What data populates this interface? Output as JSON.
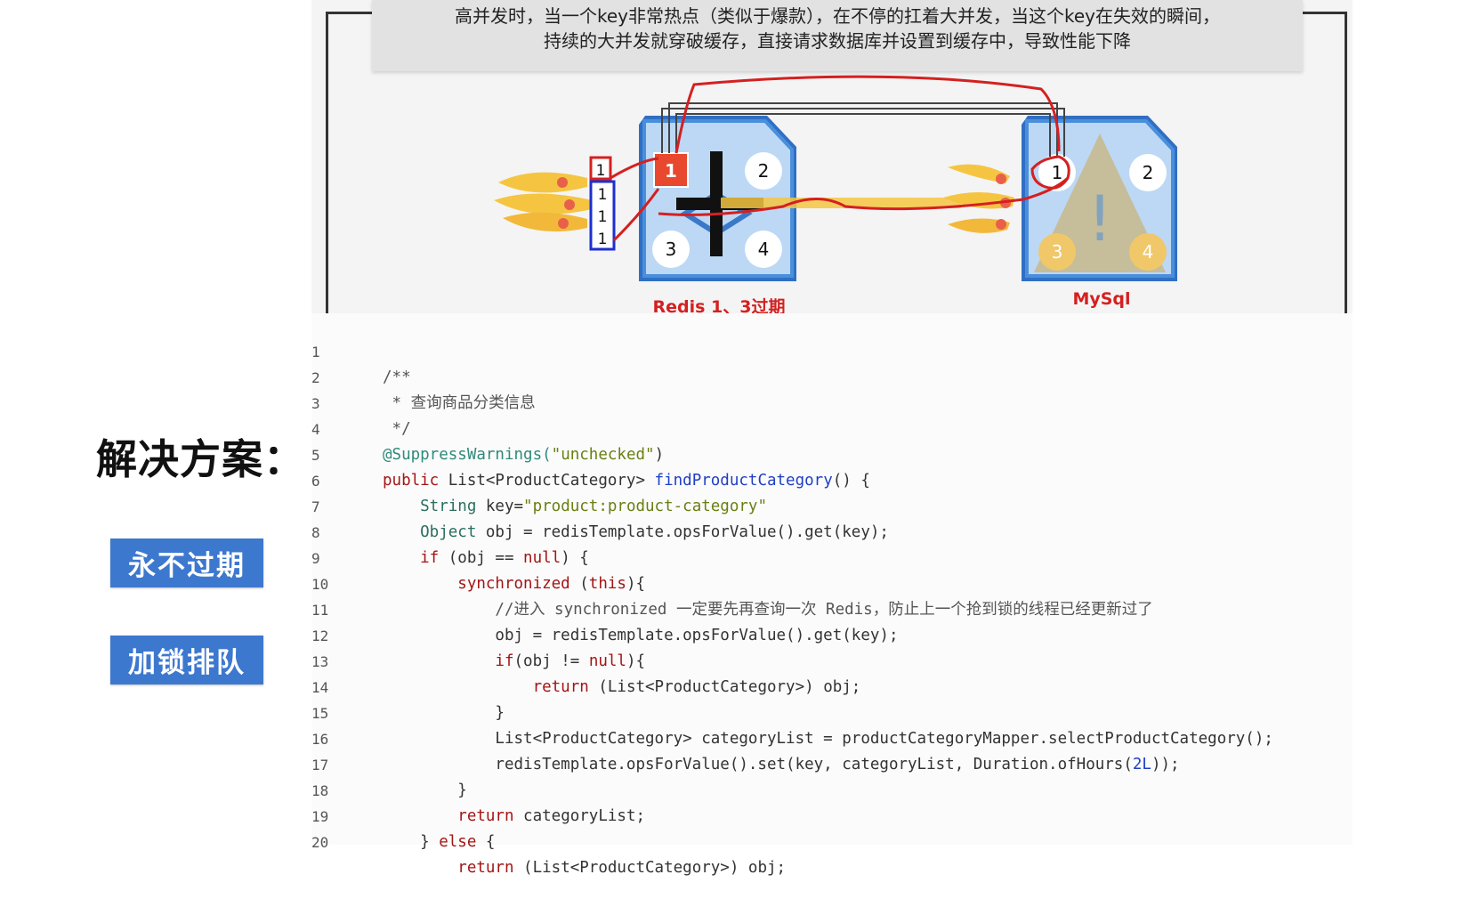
{
  "callout": {
    "line1": "高并发时，当一个key非常热点（类似于爆款），在不停的扛着大并发，当这个key在失效的瞬间，",
    "line2": "持续的大并发就穿破缓存，直接请求数据库并设置到缓存中，导致性能下降"
  },
  "diagram": {
    "redis_caption": "Redis 1、3过期",
    "mysql_caption": "MySql",
    "redis_slots": [
      "1",
      "2",
      "3",
      "4"
    ],
    "mysql_slots": [
      "1",
      "2",
      "3",
      "4"
    ],
    "queue_items": [
      "1",
      "1",
      "1",
      "1"
    ],
    "colors": {
      "annotation_red": "#d42020",
      "queue_blue": "#1c2fd0",
      "cube_blue": "#4a8fdc",
      "flame": "#f5c542"
    }
  },
  "solution": {
    "title": "解决方案：",
    "buttons": [
      "永不过期",
      "加锁排队"
    ]
  },
  "code": {
    "line_numbers": [
      "1",
      "2",
      "3",
      "4",
      "5",
      "6",
      "7",
      "8",
      "9",
      "10",
      "11",
      "12",
      "13",
      "14",
      "15",
      "16",
      "17",
      "18",
      "19",
      "20"
    ],
    "l1": "/**",
    "l2": " * 查询商品分类信息",
    "l3": " */",
    "l4a": "@SuppressWarnings(",
    "l4b": "\"unchecked\"",
    "l4c": ")",
    "l5a": "public",
    "l5b": " List<ProductCategory> ",
    "l5c": "findProductCategory",
    "l5d": "() {",
    "l6a": "    String",
    "l6b": " key=",
    "l6c": "\"product:product-category\"",
    "l7a": "    Object",
    "l7b": " obj = redisTemplate.opsForValue().get(key);",
    "l8a": "    if",
    "l8b": " (obj == ",
    "l8c": "null",
    "l8d": ") {",
    "l9a": "        synchronized",
    "l9b": " (",
    "l9c": "this",
    "l9d": "){",
    "l10": "            //进入 synchronized 一定要先再查询一次 Redis，防止上一个抢到锁的线程已经更新过了",
    "l11": "            obj = redisTemplate.opsForValue().get(key);",
    "l12a": "            if",
    "l12b": "(obj != ",
    "l12c": "null",
    "l12d": "){",
    "l13a": "                return",
    "l13b": " (List<ProductCategory>) obj;",
    "l14": "            }",
    "l15": "            List<ProductCategory> categoryList = productCategoryMapper.selectProductCategory();",
    "l16a": "            redisTemplate.opsForValue().set(key, categoryList, Duration.ofHours(",
    "l16b": "2L",
    "l16c": "));",
    "l17": "        }",
    "l18a": "        return",
    "l18b": " categoryList;",
    "l19a": "    } ",
    "l19b": "else",
    "l19c": " {",
    "l20a": "        return",
    "l20b": " (List<ProductCategory>) obj;"
  }
}
